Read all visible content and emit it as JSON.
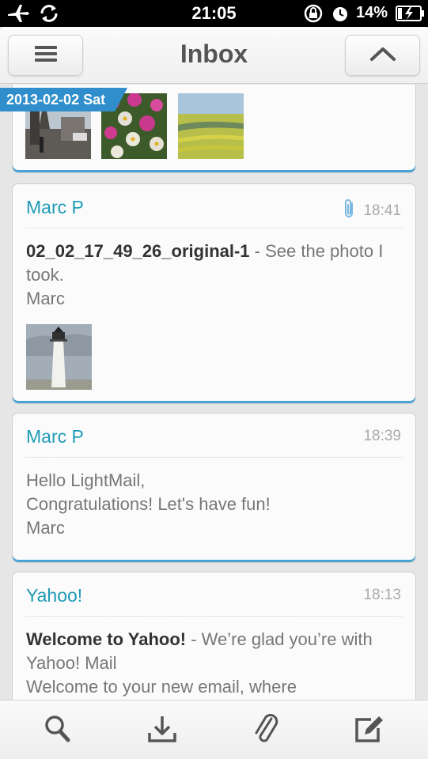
{
  "status_bar": {
    "time": "21:05",
    "battery_percent": "14%"
  },
  "nav": {
    "title": "Inbox"
  },
  "top_card": {
    "date_tag": "2013-02-02 Sat"
  },
  "messages": [
    {
      "sender": "Marc P",
      "time": "18:41",
      "has_attachment": true,
      "subject": "02_02_17_49_26_original-1",
      "preview_lines": [
        " - See the photo I took.",
        "Marc"
      ]
    },
    {
      "sender": "Marc P",
      "time": "18:39",
      "has_attachment": false,
      "subject": "",
      "preview_lines": [
        "Hello LightMail,",
        "Congratulations! Let's have fun!",
        "Marc"
      ]
    },
    {
      "sender": "Yahoo!",
      "time": "18:13",
      "has_attachment": false,
      "subject": "Welcome to Yahoo!",
      "preview_lines": [
        " - We’re glad you’re with Yahoo! Mail",
        "Welcome to your new email, where"
      ]
    }
  ],
  "toolbar": {
    "icons": [
      "search-icon",
      "download-icon",
      "attachment-icon",
      "compose-icon"
    ]
  },
  "colors": {
    "accent": "#1e9bb8",
    "card_underline": "#49a3d4",
    "date_tag": "#2f8ecb"
  }
}
